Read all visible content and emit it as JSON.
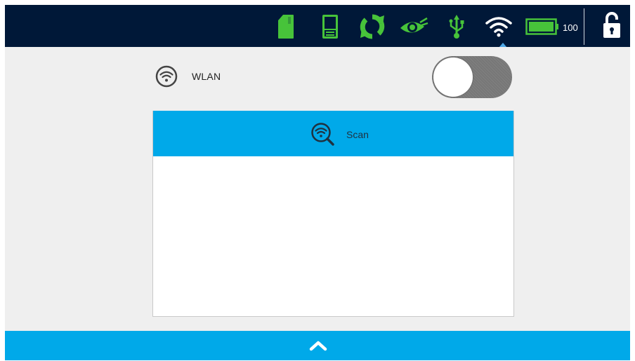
{
  "status_bar": {
    "icons": [
      "sd-card-icon",
      "device-icon",
      "sync-icon",
      "eye-icon",
      "usb-icon",
      "wifi-icon",
      "battery-icon",
      "unlock-icon"
    ],
    "battery_level": "100",
    "icon_color": "#47c33a",
    "background": "#001838"
  },
  "wlan": {
    "label": "WLAN",
    "enabled": false
  },
  "scan": {
    "label": "Scan"
  },
  "networks": [],
  "colors": {
    "accent": "#00a9e9",
    "page_background": "#efefef"
  }
}
